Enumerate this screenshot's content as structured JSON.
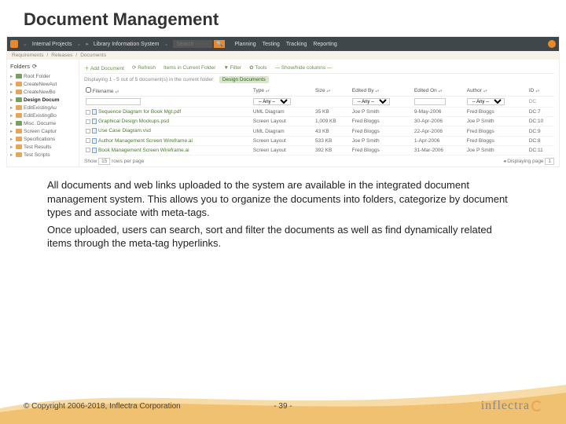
{
  "title": "Document Management",
  "topbar": {
    "project_group": "Internal Projects",
    "project": "Library Information System",
    "search_placeholder": "Search",
    "menu": [
      "Planning",
      "Testing",
      "Tracking",
      "Reporting"
    ]
  },
  "crumbs": [
    "Requirements",
    "Releases",
    "Documents"
  ],
  "sidebar": {
    "header": "Folders",
    "items": [
      {
        "label": "Root Folder",
        "sel": false,
        "g": true
      },
      {
        "label": "CreateNewAut",
        "sel": false
      },
      {
        "label": "CreateNewBo",
        "sel": false
      },
      {
        "label": "Design Docum",
        "sel": true,
        "g": true
      },
      {
        "label": "EditExistingAu",
        "sel": false
      },
      {
        "label": "EditExistingBo",
        "sel": false
      },
      {
        "label": "Misc. Docume",
        "sel": false,
        "g": true
      },
      {
        "label": "Screen Captur",
        "sel": false
      },
      {
        "label": "Specifications",
        "sel": false
      },
      {
        "label": "Test Results",
        "sel": false
      },
      {
        "label": "Test Scripts",
        "sel": false
      }
    ]
  },
  "toolbar": {
    "add": "Add Document",
    "refresh": "Refresh",
    "items_in": "Items in Current Folder",
    "filter": "Filter",
    "tools": "Tools",
    "showhide": "Show/hide columns"
  },
  "status": {
    "text": "Displaying 1 - 5 out of 5 document(s) in the current folder:",
    "chip": "Design Documents"
  },
  "columns": [
    "Filename",
    "Type",
    "Size",
    "Edited By",
    "Edited On",
    "Author",
    "ID"
  ],
  "filter_any": "-- Any --",
  "filter_dc": "DC",
  "rows": [
    {
      "name": "Sequence Diagram for Book Mgt.pdf",
      "type": "UML Diagram",
      "size": "35 KB",
      "editedby": "Joe P Smith",
      "editedon": "9-May-2006",
      "author": "Fred Bloggs",
      "id": "DC:7"
    },
    {
      "name": "Graphical Design Mockups.psd",
      "type": "Screen Layout",
      "size": "1,009 KB",
      "editedby": "Fred Bloggs",
      "editedon": "30-Apr-2006",
      "author": "Joe P Smith",
      "id": "DC:10"
    },
    {
      "name": "Use Case Diagram.vsd",
      "type": "UML Diagram",
      "size": "43 KB",
      "editedby": "Fred Bloggs",
      "editedon": "22-Apr-2006",
      "author": "Fred Bloggs",
      "id": "DC:9"
    },
    {
      "name": "Author Management Screen Wireframe.ai",
      "type": "Screen Layout",
      "size": "533 KB",
      "editedby": "Joe P Smith",
      "editedon": "1-Apr-2006",
      "author": "Fred Bloggs",
      "id": "DC:8"
    },
    {
      "name": "Book Management Screen Wireframe.ai",
      "type": "Screen Layout",
      "size": "392 KB",
      "editedby": "Fred Bloggs",
      "editedon": "31-Mar-2006",
      "author": "Joe P Smith",
      "id": "DC:11"
    }
  ],
  "pager": {
    "show": "Show",
    "per": "15",
    "rows_label": "rows per page",
    "disp": "Displaying page",
    "page": "1"
  },
  "desc": {
    "p1": "All documents and web links uploaded to the system are available in the integrated document management system. This allows you to organize the documents into folders, categorize by document types and associate with meta-tags.",
    "p2": "Once uploaded, users can search, sort and filter the documents as well as find dynamically related items through the meta-tag hyperlinks."
  },
  "footer": {
    "copyright": "© Copyright 2006-2018, Inflectra Corporation",
    "page": "- 39 -",
    "brand": "inflectra"
  }
}
